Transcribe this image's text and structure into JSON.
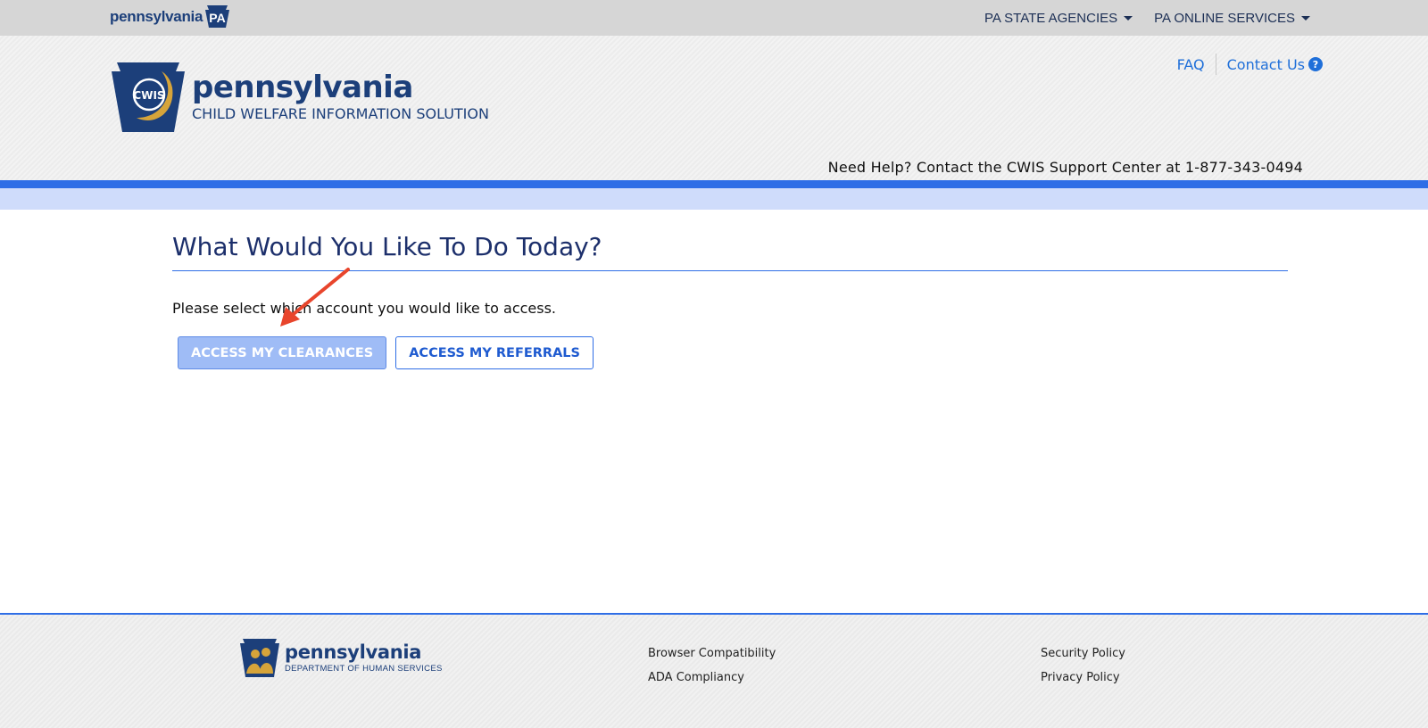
{
  "topbar": {
    "logo_text": "pennsylvania",
    "logo_badge": "PA",
    "nav": [
      {
        "label": "PA STATE AGENCIES"
      },
      {
        "label": "PA ONLINE SERVICES"
      }
    ]
  },
  "header": {
    "badge_text": "CWIS",
    "brand_name": "pennsylvania",
    "brand_sub": "CHILD WELFARE INFORMATION SOLUTION",
    "faq_label": "FAQ",
    "contact_label": "Contact Us",
    "help_text": "Need Help? Contact the CWIS Support Center at 1-877-343-0494"
  },
  "main": {
    "title": "What Would You Like To Do Today?",
    "prompt": "Please select which account you would like to access.",
    "buttons": [
      {
        "label": "ACCESS MY CLEARANCES"
      },
      {
        "label": "ACCESS MY REFERRALS"
      }
    ]
  },
  "footer": {
    "brand_name": "pennsylvania",
    "brand_sub": "DEPARTMENT OF HUMAN SERVICES",
    "links_col1": [
      "Browser Compatibility",
      "ADA Compliancy"
    ],
    "links_col2": [
      "Security Policy",
      "Privacy Policy"
    ]
  },
  "colors": {
    "brand_navy": "#1c3f7a",
    "accent_blue": "#2f6ee6",
    "light_blue_bar": "#cfdcfb",
    "primary_button": "#9fbcf6",
    "annotation_arrow": "#e8452c"
  }
}
